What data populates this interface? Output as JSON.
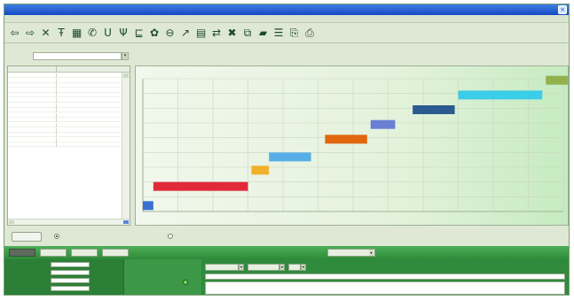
{
  "window": {
    "title": ""
  },
  "menu": [
    {
      "label": "",
      "x": 2
    },
    {
      "label": "",
      "x": 16
    },
    {
      "label": "",
      "x": 30
    },
    {
      "label": "",
      "x": 46
    },
    {
      "label": "",
      "x": 66
    }
  ],
  "toolbar": {
    "icons": [
      {
        "name": "back-arrow-icon",
        "glyph": "⇦"
      },
      {
        "name": "forward-arrow-icon",
        "glyph": "⇨"
      },
      {
        "name": "close-cross-icon",
        "glyph": "✕"
      },
      {
        "name": "font-icon",
        "glyph": "Ŧ"
      },
      {
        "name": "calendar-icon",
        "glyph": "▦"
      },
      {
        "name": "chart-icon",
        "glyph": "✆"
      },
      {
        "name": "underline-icon",
        "glyph": "U"
      },
      {
        "name": "percent-icon",
        "glyph": "Ψ"
      },
      {
        "name": "tree-icon",
        "glyph": "⊑"
      },
      {
        "name": "gear-icon",
        "glyph": "✿"
      },
      {
        "name": "zoom-icon",
        "glyph": "⊖"
      },
      {
        "name": "pointer-icon",
        "glyph": "↗"
      },
      {
        "name": "table-icon",
        "glyph": "▤"
      },
      {
        "name": "link-icon",
        "glyph": "⇄"
      },
      {
        "name": "delete-icon",
        "glyph": "✖"
      },
      {
        "name": "copy-icon",
        "glyph": "⧉"
      },
      {
        "name": "tag-icon",
        "glyph": "▰"
      },
      {
        "name": "list-icon",
        "glyph": "☰"
      },
      {
        "name": "save-icon",
        "glyph": "⎘"
      },
      {
        "name": "print-icon",
        "glyph": "⎙"
      }
    ]
  },
  "filter": {
    "label": "",
    "date_value": ""
  },
  "list": {
    "col_id": "",
    "col_name": "",
    "rows": [
      {
        "id": "",
        "name": ""
      },
      {
        "id": "",
        "name": ""
      },
      {
        "id": "",
        "name": ""
      },
      {
        "id": "",
        "name": ""
      },
      {
        "id": "",
        "name": ""
      },
      {
        "id": "",
        "name": ""
      },
      {
        "id": "",
        "name": ""
      },
      {
        "id": "",
        "name": ""
      },
      {
        "id": "",
        "name": ""
      },
      {
        "id": "",
        "name": ""
      },
      {
        "id": "",
        "name": ""
      },
      {
        "id": "",
        "name": ""
      },
      {
        "id": "",
        "name": ""
      },
      {
        "id": "",
        "name": ""
      },
      {
        "id": "",
        "name": ""
      }
    ]
  },
  "chart_data": {
    "type": "bar",
    "title": "",
    "xlabel": "",
    "ylabel": "",
    "x_ticks": [
      "",
      "",
      "",
      "",
      "",
      "",
      "",
      "",
      "",
      "",
      "",
      "",
      ""
    ],
    "y_ticks": [
      "",
      "",
      "",
      "",
      "",
      "",
      "",
      "",
      "",
      ""
    ],
    "colors": [
      "#3a6fd0",
      "#e02a3a",
      "#f2b12a",
      "#58aee6",
      "#e2660e",
      "#6b7fd6",
      "#2b5a8f",
      "#3ccde8",
      "#92b14c"
    ],
    "bars": [
      {
        "start": 0.0,
        "end": 0.3,
        "level": 0.4
      },
      {
        "start": 0.3,
        "end": 3.0,
        "level": 1.7
      },
      {
        "start": 3.1,
        "end": 3.6,
        "level": 2.8
      },
      {
        "start": 3.6,
        "end": 4.8,
        "level": 3.7
      },
      {
        "start": 5.2,
        "end": 6.4,
        "level": 4.9
      },
      {
        "start": 6.5,
        "end": 7.2,
        "level": 5.9
      },
      {
        "start": 7.7,
        "end": 8.9,
        "level": 6.9
      },
      {
        "start": 9.0,
        "end": 11.4,
        "level": 7.9
      },
      {
        "start": 11.5,
        "end": 12.6,
        "level": 8.9
      }
    ]
  },
  "controls": {
    "edit_button": "",
    "radio1_label": "",
    "radio2_label": ""
  },
  "bottom": {
    "nav_buttons": [
      "",
      "",
      "",
      ""
    ],
    "view_label": "",
    "view_select": "",
    "props": [
      {
        "label": "",
        "value": ""
      },
      {
        "label": "",
        "value": ""
      },
      {
        "label": "",
        "value": ""
      },
      {
        "label": "",
        "value": ""
      }
    ],
    "detail_labels": [
      "",
      ""
    ],
    "mini_selects": [
      "",
      "",
      ""
    ],
    "description": "",
    "notes": ""
  }
}
